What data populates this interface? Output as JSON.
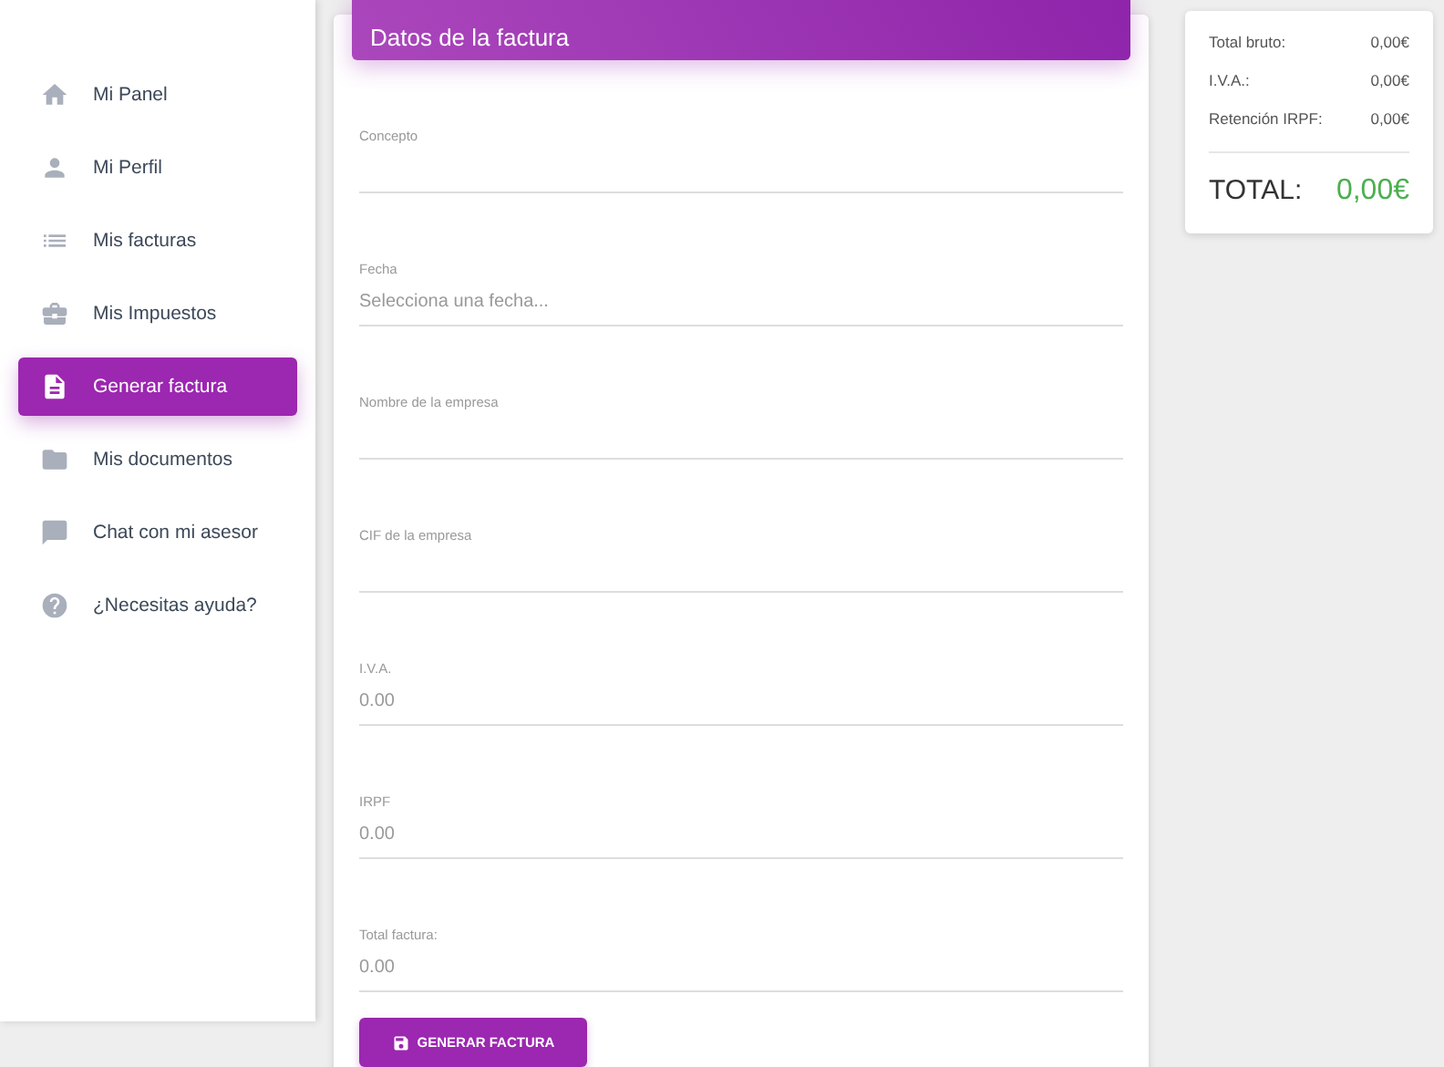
{
  "sidebar": {
    "items": [
      {
        "label": "Mi Panel",
        "selected": false
      },
      {
        "label": "Mi Perfil",
        "selected": false
      },
      {
        "label": "Mis facturas",
        "selected": false
      },
      {
        "label": "Mis Impuestos",
        "selected": false
      },
      {
        "label": "Generar factura",
        "selected": true
      },
      {
        "label": "Mis documentos",
        "selected": false
      },
      {
        "label": "Chat con mi asesor",
        "selected": false
      },
      {
        "label": "¿Necesitas ayuda?",
        "selected": false
      }
    ]
  },
  "form": {
    "title": "Datos de la factura",
    "fields": [
      {
        "label": "Concepto"
      },
      {
        "label": "Fecha",
        "placeholder": "Selecciona una fecha..."
      },
      {
        "label": "Nombre de la empresa"
      },
      {
        "label": "CIF de la empresa"
      },
      {
        "label": "I.V.A.",
        "placeholder": "0.00"
      },
      {
        "label": "IRPF",
        "placeholder": "0.00"
      },
      {
        "label": "Total factura:",
        "placeholder": "0.00"
      }
    ],
    "button": "GENERAR FACTURA"
  },
  "summary": {
    "rows": [
      {
        "label": "Total bruto:",
        "value": "0,00€"
      },
      {
        "label": "I.V.A.:",
        "value": "0,00€"
      },
      {
        "label": "Retención IRPF:",
        "value": "0,00€"
      }
    ],
    "total_label": "TOTAL:",
    "total_value": "0,00€"
  }
}
